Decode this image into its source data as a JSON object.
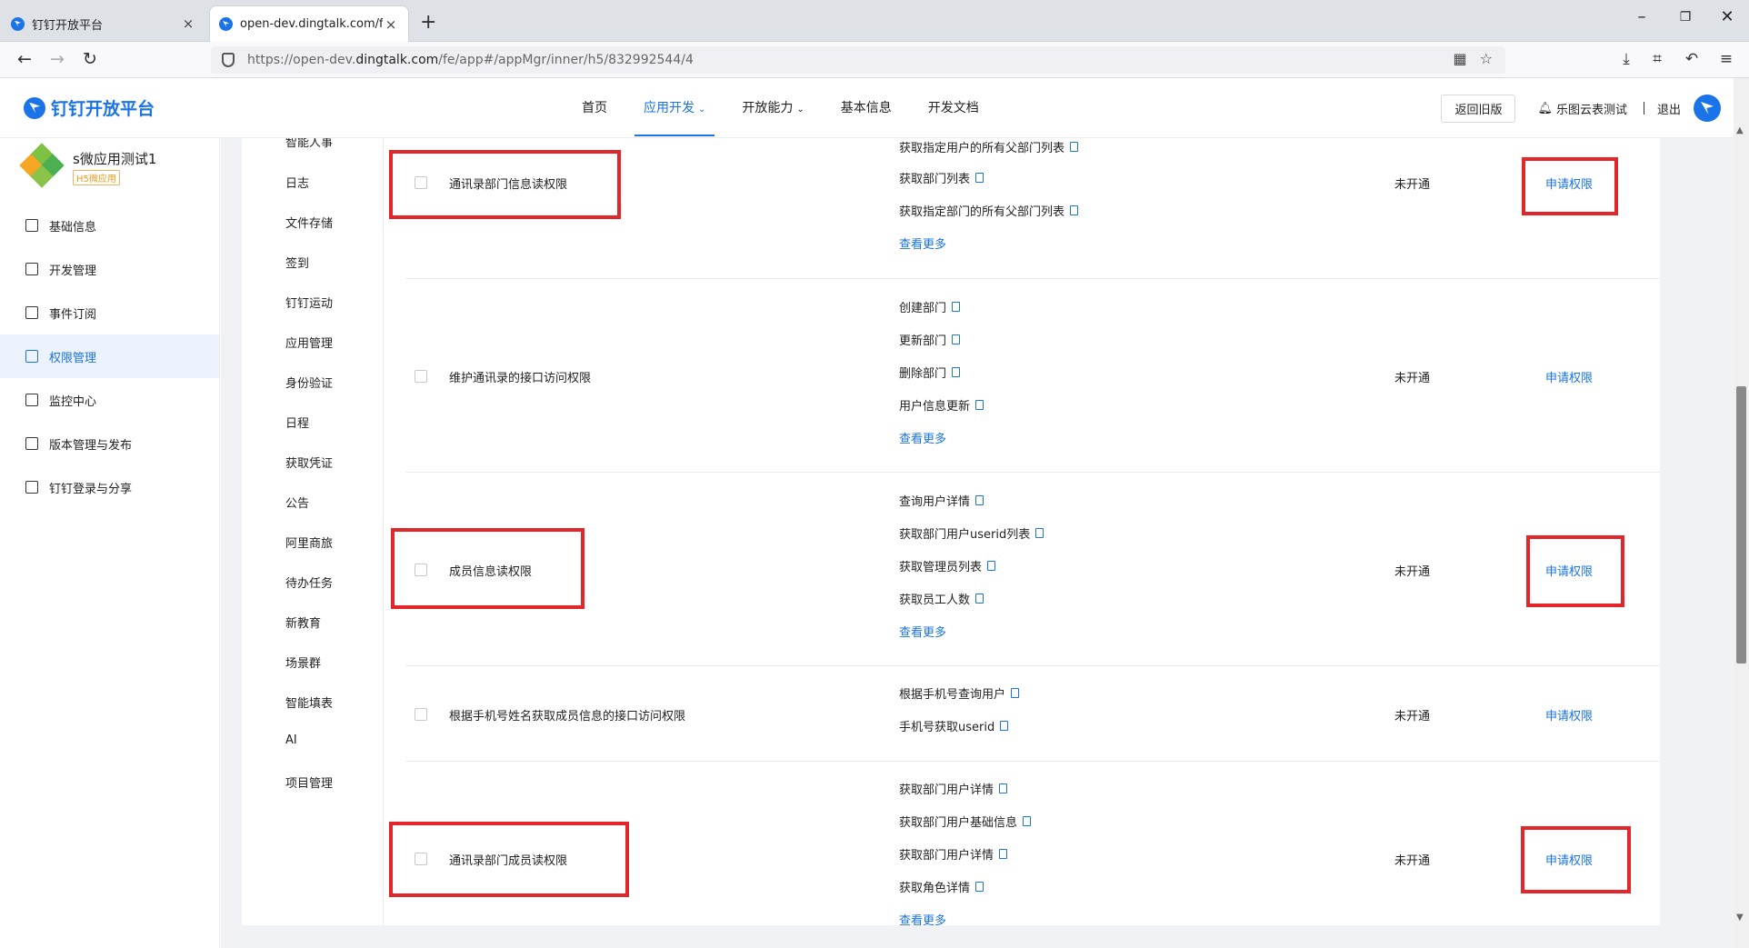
{
  "browser": {
    "tabs": [
      {
        "title": "钉钉开放平台"
      },
      {
        "title": "open-dev.dingtalk.com/fe/app"
      }
    ],
    "url": {
      "prefix": "https://open-dev.",
      "host": "dingtalk.com",
      "path": "/fe/app#/appMgr/inner/h5/832992544/4"
    }
  },
  "header": {
    "logo_text": "钉钉开放平台",
    "nav": [
      {
        "label": "首页"
      },
      {
        "label": "应用开发"
      },
      {
        "label": "开放能力"
      },
      {
        "label": "基本信息"
      },
      {
        "label": "开发文档"
      }
    ],
    "old_version_label": "返回旧版",
    "org_name": "乐图云表测试",
    "logout_label": "退出"
  },
  "app": {
    "name": "s微应用测试1",
    "tag": "H5微应用"
  },
  "sidebar": {
    "items": [
      {
        "label": "基础信息"
      },
      {
        "label": "开发管理"
      },
      {
        "label": "事件订阅"
      },
      {
        "label": "权限管理"
      },
      {
        "label": "监控中心"
      },
      {
        "label": "版本管理与发布"
      },
      {
        "label": "钉钉登录与分享"
      }
    ]
  },
  "categories": [
    "智能人事",
    "日志",
    "文件存储",
    "签到",
    "钉钉运动",
    "应用管理",
    "身份验证",
    "日程",
    "获取凭证",
    "公告",
    "阿里商旅",
    "待办任务",
    "新教育",
    "场景群",
    "智能填表",
    "AI",
    "项目管理"
  ],
  "permissions": {
    "status_label": "未开通",
    "apply_label": "申请权限",
    "more_label": "查看更多",
    "rows": [
      {
        "name": "通讯录部门信息读权限",
        "apis": [
          "获取指定用户的所有父部门列表",
          "获取部门列表",
          "获取指定部门的所有父部门列表"
        ]
      },
      {
        "name": "维护通讯录的接口访问权限",
        "apis": [
          "创建部门",
          "更新部门",
          "删除部门",
          "用户信息更新"
        ]
      },
      {
        "name": "成员信息读权限",
        "apis": [
          "查询用户详情",
          "获取部门用户userid列表",
          "获取管理员列表",
          "获取员工人数"
        ]
      },
      {
        "name": "根据手机号姓名获取成员信息的接口访问权限",
        "apis": [
          "根据手机号查询用户",
          "手机号获取userid"
        ]
      },
      {
        "name": "通讯录部门成员读权限",
        "apis": [
          "获取部门用户详情",
          "获取部门用户基础信息",
          "获取部门用户详情",
          "获取角色详情"
        ]
      }
    ]
  }
}
